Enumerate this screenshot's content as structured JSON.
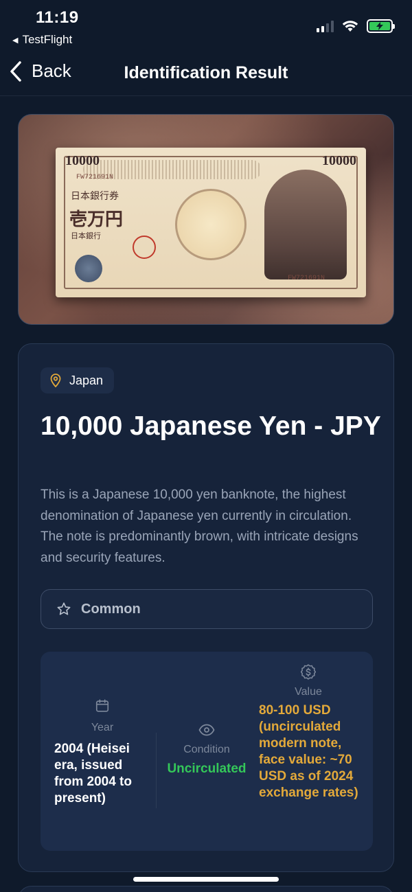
{
  "status": {
    "time": "11:19",
    "back_app": "TestFlight"
  },
  "nav": {
    "back_label": "Back",
    "title": "Identification Result"
  },
  "note_art": {
    "denomination": "10000",
    "serial": "FW721691N",
    "kanji_top": "日本銀行券",
    "kanji_main": "壱万円",
    "kanji_bottom": "日本銀行"
  },
  "result": {
    "country": "Japan",
    "title": "10,000 Japanese Yen - JPY",
    "description": "This is a Japanese 10,000 yen banknote, the highest denomination of Japanese yen currently in circulation. The note is predominantly brown, with intricate designs and security features.",
    "rarity": "Common"
  },
  "stats": {
    "year": {
      "label": "Year",
      "value": "2004 (Heisei era, issued from 2004 to present)"
    },
    "condition": {
      "label": "Condition",
      "value": "Uncirculated"
    },
    "value": {
      "label": "Value",
      "value": "80-100 USD (uncirculated modern note, face value: ~70 USD as of 2024 exchange rates)"
    }
  },
  "colors": {
    "background": "#0f1a2b",
    "card": "#16233a",
    "condition_green": "#34c759",
    "value_gold": "#e3a93a",
    "muted_text": "#9aa5b8"
  },
  "icons": {
    "location": "map-pin-icon",
    "rarity": "star-icon",
    "year": "calendar-icon",
    "condition": "eye-icon",
    "value": "dollar-badge-icon"
  }
}
